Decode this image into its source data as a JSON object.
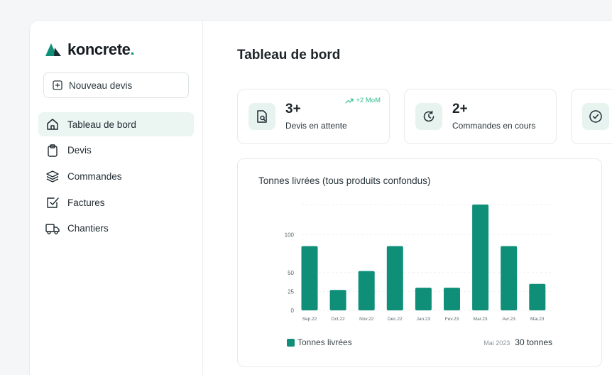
{
  "brand": {
    "name": "koncrete",
    "dot": ".",
    "accent": "#0f8f78"
  },
  "sidebar": {
    "new_button": "Nouveau devis",
    "items": [
      {
        "label": "Tableau de bord",
        "icon": "home-icon",
        "active": true
      },
      {
        "label": "Devis",
        "icon": "clipboard-icon",
        "active": false
      },
      {
        "label": "Commandes",
        "icon": "layers-icon",
        "active": false
      },
      {
        "label": "Factures",
        "icon": "checkbox-icon",
        "active": false
      },
      {
        "label": "Chantiers",
        "icon": "truck-icon",
        "active": false
      }
    ]
  },
  "main": {
    "title": "Tableau de bord",
    "stats": [
      {
        "value": "3+",
        "label": "Devis en attente",
        "trend": "+2 MoM",
        "icon": "document-search-icon"
      },
      {
        "value": "2+",
        "label": "Commandes en cours",
        "icon": "clock-refresh-icon"
      },
      {
        "value": "",
        "label": "",
        "icon": "check-circle-icon"
      }
    ]
  },
  "chart_data": {
    "type": "bar",
    "title": "Tonnes livrées (tous produits confondus)",
    "categories": [
      "Sep.22",
      "Oct.22",
      "Nov.22",
      "Dec.22",
      "Jan.23",
      "Fev.23",
      "Mar.23",
      "Avr.23",
      "Mai.23"
    ],
    "series": [
      {
        "name": "Tonnes livrées",
        "values": [
          85,
          27,
          52,
          85,
          30,
          30,
          140,
          85,
          35
        ]
      }
    ],
    "y_ticks": [
      0,
      25,
      50,
      100
    ],
    "ylim": [
      0,
      140
    ],
    "grid": true,
    "legend": "bottom-left",
    "color": "#0f8f78",
    "summary": {
      "period": "Mai 2023",
      "value": "30 tonnes"
    }
  }
}
